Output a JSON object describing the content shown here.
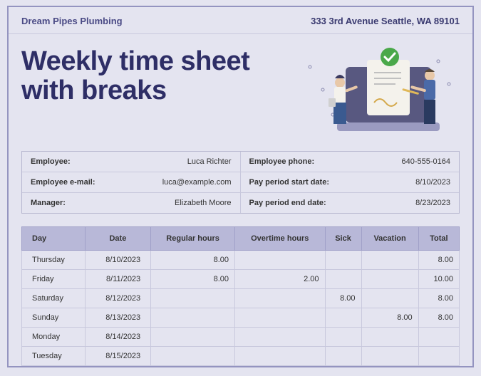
{
  "header": {
    "company": "Dream Pipes Plumbing",
    "address": "333 3rd Avenue Seattle, WA 89101"
  },
  "title_line1": "Weekly time sheet",
  "title_line2": "with breaks",
  "info": {
    "employee_label": "Employee:",
    "employee_value": "Luca Richter",
    "phone_label": "Employee phone:",
    "phone_value": "640-555-0164",
    "email_label": "Employee e-mail:",
    "email_value": "luca@example.com",
    "period_start_label": "Pay period start date:",
    "period_start_value": "8/10/2023",
    "manager_label": "Manager:",
    "manager_value": "Elizabeth Moore",
    "period_end_label": "Pay period end date:",
    "period_end_value": "8/23/2023"
  },
  "table": {
    "headers": {
      "day": "Day",
      "date": "Date",
      "regular": "Regular hours",
      "overtime": "Overtime hours",
      "sick": "Sick",
      "vacation": "Vacation",
      "total": "Total"
    },
    "rows": [
      {
        "day": "Thursday",
        "date": "8/10/2023",
        "regular": "8.00",
        "overtime": "",
        "sick": "",
        "vacation": "",
        "total": "8.00"
      },
      {
        "day": "Friday",
        "date": "8/11/2023",
        "regular": "8.00",
        "overtime": "2.00",
        "sick": "",
        "vacation": "",
        "total": "10.00"
      },
      {
        "day": "Saturday",
        "date": "8/12/2023",
        "regular": "",
        "overtime": "",
        "sick": "8.00",
        "vacation": "",
        "total": "8.00"
      },
      {
        "day": "Sunday",
        "date": "8/13/2023",
        "regular": "",
        "overtime": "",
        "sick": "",
        "vacation": "8.00",
        "total": "8.00"
      },
      {
        "day": "Monday",
        "date": "8/14/2023",
        "regular": "",
        "overtime": "",
        "sick": "",
        "vacation": "",
        "total": ""
      },
      {
        "day": "Tuesday",
        "date": "8/15/2023",
        "regular": "",
        "overtime": "",
        "sick": "",
        "vacation": "",
        "total": ""
      }
    ]
  }
}
